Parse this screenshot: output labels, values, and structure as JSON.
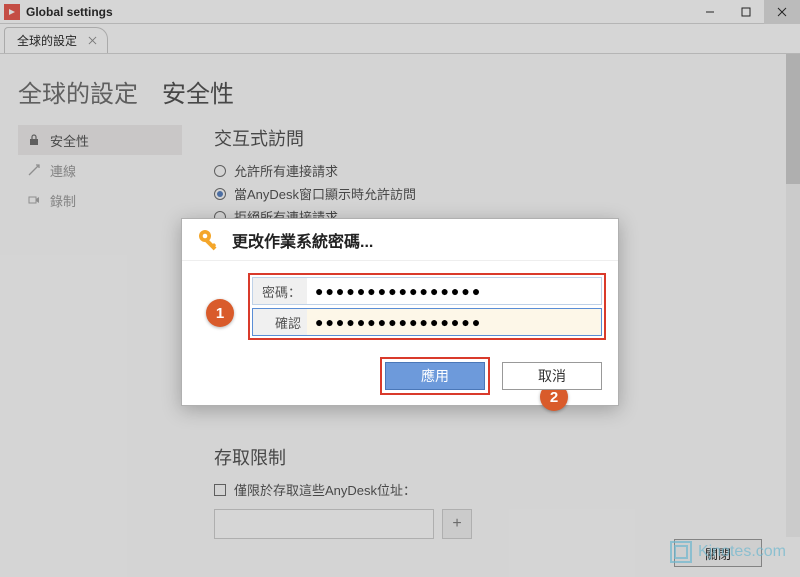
{
  "window": {
    "title": "Global settings",
    "tab_label": "全球的設定"
  },
  "page": {
    "breadcrumb": "全球的設定",
    "heading": "安全性"
  },
  "sidebar": {
    "items": [
      {
        "label": "安全性",
        "icon": "lock-icon"
      },
      {
        "label": "連線",
        "icon": "connection-icon"
      },
      {
        "label": "錄制",
        "icon": "record-icon"
      }
    ]
  },
  "section_interactive": {
    "title": "交互式訪問",
    "options": [
      {
        "label": "允許所有連接請求",
        "selected": false
      },
      {
        "label": "當AnyDesk窗口顯示時允許訪問",
        "selected": true
      },
      {
        "label": "拒絕所有連接請求",
        "selected": false
      }
    ]
  },
  "section_access": {
    "title": "存取限制",
    "checkbox_label": "僅限於存取這些AnyDesk位址：",
    "add_button": "+"
  },
  "footer": {
    "close_label": "關閉"
  },
  "dialog": {
    "title": "更改作業系統密碼...",
    "password_label": "密碼：",
    "confirm_label": "確認",
    "password_mask": "●●●●●●●●●●●●●●●●",
    "confirm_mask": "●●●●●●●●●●●●●●●●",
    "apply_label": "應用",
    "cancel_label": "取消",
    "annotations": {
      "step1": "1",
      "step2": "2"
    }
  },
  "watermark": "Kjnotes.com"
}
